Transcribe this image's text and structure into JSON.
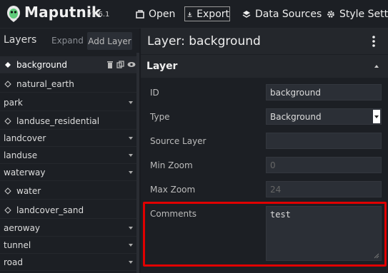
{
  "app": {
    "name": "Maputnik",
    "version": "v1.6.1"
  },
  "toolbar": {
    "open_label": "Open",
    "export_label": "Export",
    "data_sources_label": "Data Sources",
    "style_settings_label": "Style Settin"
  },
  "layers_panel": {
    "title": "Layers",
    "expand_label": "Expand",
    "add_layer_label": "Add Layer",
    "items": [
      {
        "label": "background",
        "type": "layer"
      },
      {
        "label": "natural_earth",
        "type": "layer"
      },
      {
        "label": "park",
        "type": "group"
      },
      {
        "label": "landuse_residential",
        "type": "layer"
      },
      {
        "label": "landcover",
        "type": "group"
      },
      {
        "label": "landuse",
        "type": "group"
      },
      {
        "label": "waterway",
        "type": "group"
      },
      {
        "label": "water",
        "type": "layer"
      },
      {
        "label": "landcover_sand",
        "type": "layer"
      },
      {
        "label": "aeroway",
        "type": "group"
      },
      {
        "label": "tunnel",
        "type": "group"
      },
      {
        "label": "road",
        "type": "group"
      }
    ]
  },
  "editor": {
    "title": "Layer: background",
    "group_title": "Layer",
    "fields": {
      "id": {
        "label": "ID",
        "value": "background"
      },
      "type": {
        "label": "Type",
        "value": "Background"
      },
      "source_layer": {
        "label": "Source Layer",
        "value": ""
      },
      "min_zoom": {
        "label": "Min Zoom",
        "placeholder": "0"
      },
      "max_zoom": {
        "label": "Max Zoom",
        "placeholder": "24"
      },
      "comments": {
        "label": "Comments",
        "value": "test"
      }
    }
  },
  "colors": {
    "highlight": "#e00000",
    "panel": "#1c1f24",
    "logo_accent": "#5fcb7a"
  }
}
